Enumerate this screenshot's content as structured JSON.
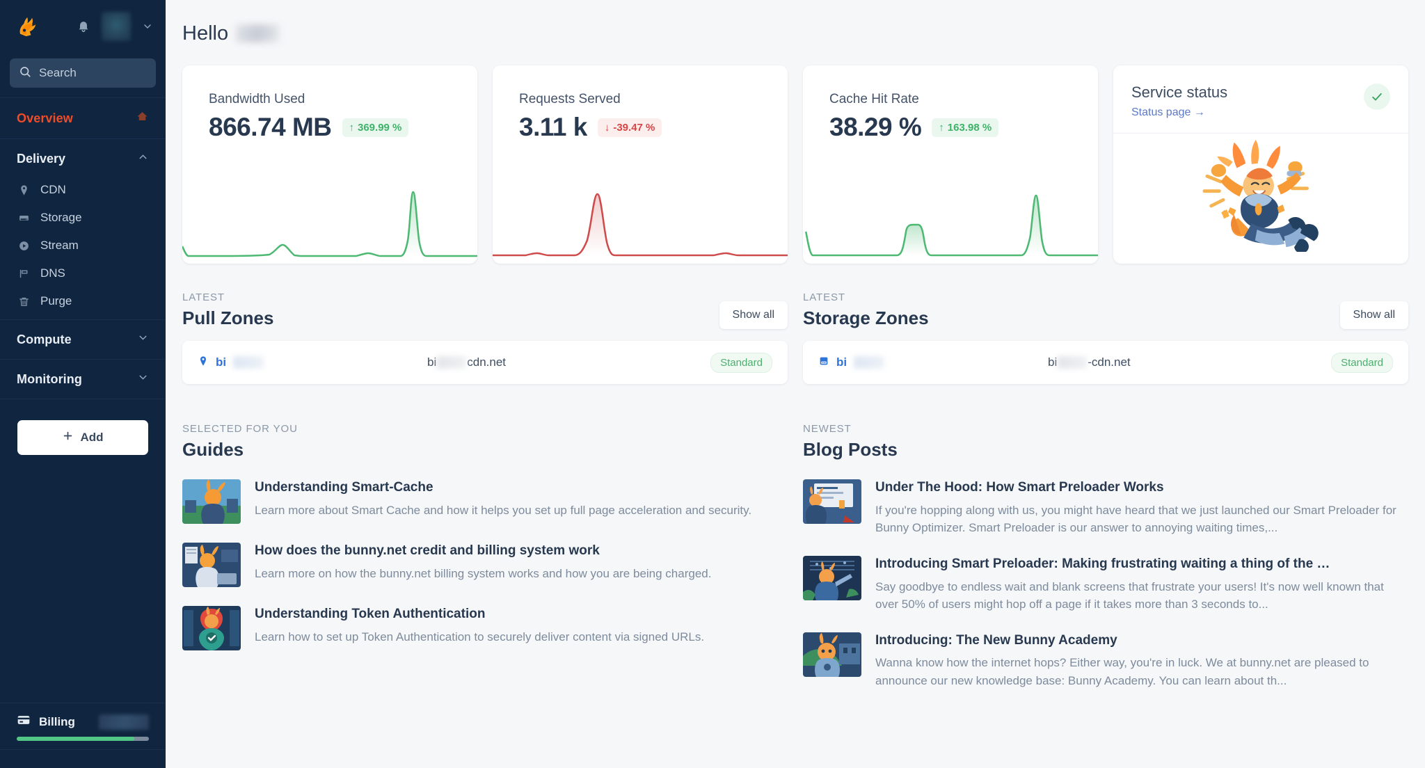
{
  "sidebar": {
    "logo_icon": "bunny-logo-icon",
    "bell_icon": "bell-icon",
    "avatar_caret_icon": "chevron-down-icon",
    "search": {
      "placeholder": "Search",
      "icon": "search-icon",
      "value": ""
    },
    "overview": {
      "label": "Overview",
      "icon": "home-icon",
      "active": true
    },
    "groups": [
      {
        "label": "Delivery",
        "expanded": true,
        "chevron": "chevron-up-icon",
        "items": [
          {
            "label": "CDN",
            "icon": "location-pin-icon"
          },
          {
            "label": "Storage",
            "icon": "storage-drive-icon"
          },
          {
            "label": "Stream",
            "icon": "play-circle-icon"
          },
          {
            "label": "DNS",
            "icon": "flag-icon"
          },
          {
            "label": "Purge",
            "icon": "trash-icon"
          }
        ]
      },
      {
        "label": "Compute",
        "expanded": false,
        "chevron": "chevron-down-icon",
        "items": []
      },
      {
        "label": "Monitoring",
        "expanded": false,
        "chevron": "chevron-down-icon",
        "items": []
      }
    ],
    "add_button": {
      "label": "Add",
      "icon": "plus-icon"
    },
    "billing": {
      "label": "Billing",
      "icon": "credit-card-icon",
      "amount_hidden": "",
      "progress_percent": 89
    },
    "colors": {
      "bg": "#10253f",
      "active": "#f04c28",
      "search_bg": "#2c445f",
      "progress": "#52c785"
    }
  },
  "header": {
    "greeting": "Hello",
    "username_hidden": ""
  },
  "stats": [
    {
      "title": "Bandwidth Used",
      "value": "866.74 MB",
      "delta": "369.99 %",
      "delta_direction": "up",
      "delta_arrow": "↑",
      "color": "#4cb872"
    },
    {
      "title": "Requests Served",
      "value": "3.11 k",
      "delta": "-39.47 %",
      "delta_direction": "down",
      "delta_arrow": "↓",
      "color": "#cf4a4a"
    },
    {
      "title": "Cache Hit Rate",
      "value": "38.29 %",
      "delta": "163.98 %",
      "delta_direction": "up",
      "delta_arrow": "↑",
      "color": "#4cb872"
    }
  ],
  "service_status": {
    "title": "Service status",
    "link_label": "Status page →",
    "ok_icon": "check-icon",
    "illustration": "celebrating-bunny-illustration"
  },
  "zones": [
    {
      "eyebrow": "LATEST",
      "title": "Pull Zones",
      "show_all_label": "Show all",
      "row": {
        "icon": "location-pin-icon",
        "name_prefix": "bi",
        "host_prefix": "bi",
        "host_suffix": "cdn.net",
        "tag": "Standard"
      }
    },
    {
      "eyebrow": "LATEST",
      "title": "Storage Zones",
      "show_all_label": "Show all",
      "row": {
        "icon": "storage-drive-icon",
        "name_prefix": "bi",
        "host_prefix": "bi",
        "host_suffix": "-cdn.net",
        "tag": "Standard"
      }
    }
  ],
  "guides": {
    "eyebrow": "SELECTED FOR YOU",
    "title": "Guides",
    "items": [
      {
        "title": "Understanding Smart-Cache",
        "desc": "Learn more about Smart Cache and how it helps you set up full page acceleration and security."
      },
      {
        "title": "How does the bunny.net credit and billing system work",
        "desc": "Learn more on how the bunny.net billing system works and how you are being charged."
      },
      {
        "title": "Understanding Token Authentication",
        "desc": "Learn how to set up Token Authentication to securely deliver content via signed URLs."
      }
    ]
  },
  "blog": {
    "eyebrow": "NEWEST",
    "title": "Blog Posts",
    "items": [
      {
        "title": "Under The Hood: How Smart Preloader Works",
        "desc": "If you're hopping along with us, you might have heard that we just launched our Smart Preloader for Bunny Optimizer. Smart Preloader is our answer to annoying waiting times,..."
      },
      {
        "title": "Introducing Smart Preloader: Making frustrating waiting a thing of the …",
        "desc": "Say goodbye to endless wait and blank screens that frustrate your users! It's now well known that over 50% of users might hop off a page if it takes more than 3 seconds to..."
      },
      {
        "title": "Introducing: The New Bunny Academy",
        "desc": "Wanna know how the internet hops? Either way, you're in luck. We at bunny.net are pleased to announce our new knowledge base: Bunny Academy. You can learn about th..."
      }
    ]
  },
  "chart_data": [
    {
      "type": "line",
      "title": "Bandwidth Used",
      "x": [
        0,
        1,
        2,
        3,
        4,
        5,
        6,
        7,
        8,
        9,
        10,
        11,
        12,
        13,
        14,
        15,
        16,
        17,
        18,
        19,
        20,
        21,
        22,
        23
      ],
      "values": [
        8,
        2,
        2,
        2,
        2,
        2,
        2,
        2,
        2,
        3,
        3,
        11,
        2,
        2,
        2,
        2,
        4,
        3,
        2,
        2,
        2,
        62,
        2,
        2
      ],
      "ylim": [
        0,
        70
      ],
      "grid": false,
      "legend": false
    },
    {
      "type": "line",
      "title": "Requests Served",
      "x": [
        0,
        1,
        2,
        3,
        4,
        5,
        6,
        7,
        8,
        9,
        10,
        11,
        12,
        13,
        14,
        15,
        16,
        17,
        18,
        19,
        20,
        21,
        22,
        23
      ],
      "values": [
        2,
        2,
        2,
        3,
        2,
        2,
        2,
        2,
        3,
        64,
        3,
        2,
        2,
        2,
        2,
        2,
        2,
        3,
        2,
        2,
        2,
        2,
        2,
        2
      ],
      "ylim": [
        0,
        70
      ],
      "grid": false,
      "legend": false
    },
    {
      "type": "line",
      "title": "Cache Hit Rate",
      "x": [
        0,
        1,
        2,
        3,
        4,
        5,
        6,
        7,
        8,
        9,
        10,
        11,
        12,
        13,
        14,
        15,
        16,
        17,
        18,
        19,
        20,
        21,
        22,
        23
      ],
      "values": [
        17,
        2,
        2,
        2,
        2,
        2,
        2,
        2,
        2,
        28,
        28,
        2,
        2,
        2,
        2,
        2,
        2,
        2,
        2,
        2,
        60,
        2,
        2,
        2
      ],
      "ylim": [
        0,
        70
      ],
      "grid": false,
      "legend": false
    }
  ]
}
